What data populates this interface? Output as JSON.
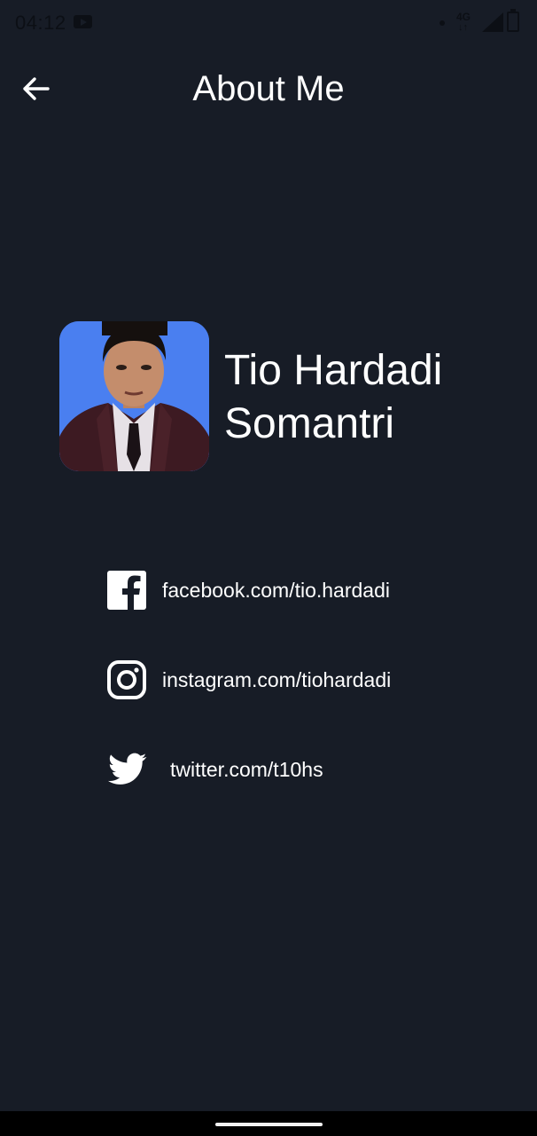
{
  "status_bar": {
    "time": "04:12",
    "network": "4G",
    "network_arrows": "↓↑"
  },
  "header": {
    "title": "About Me",
    "back_icon": "arrow-left-icon"
  },
  "profile": {
    "name_line1": "Tio Hardadi",
    "name_line2": "Somantri"
  },
  "social": {
    "facebook": {
      "icon": "facebook-icon",
      "text": "facebook.com/tio.hardadi"
    },
    "instagram": {
      "icon": "instagram-icon",
      "text": "instagram.com/tiohardadi"
    },
    "twitter": {
      "icon": "twitter-icon",
      "text": "twitter.com/t10hs"
    }
  },
  "colors": {
    "background": "#171c26",
    "text": "#ffffff",
    "avatar_background": "#4a7ff0",
    "nav_bar": "#000000"
  }
}
